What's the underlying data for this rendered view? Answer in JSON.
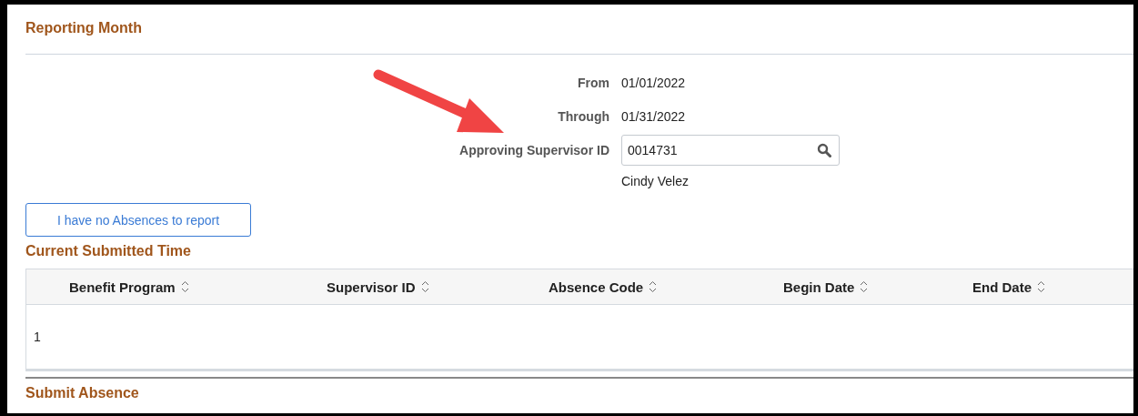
{
  "reporting_month": {
    "title": "Reporting Month",
    "fields": [
      {
        "kind": "text",
        "label": "From",
        "value": "01/01/2022"
      },
      {
        "kind": "text",
        "label": "Through",
        "value": "01/31/2022"
      },
      {
        "kind": "lookup",
        "label": "Approving Supervisor ID",
        "value": "0014731"
      }
    ],
    "supervisor_name": "Cindy Velez"
  },
  "no_absences_button": "I have no Absences to report",
  "current_submitted_time": {
    "title": "Current Submitted Time",
    "columns": [
      "Benefit Program",
      "Supervisor ID",
      "Absence Code",
      "Begin Date",
      "End Date"
    ],
    "rows": [
      {
        "row_number": "1"
      }
    ]
  },
  "next_section": {
    "title": "Submit Absence"
  }
}
